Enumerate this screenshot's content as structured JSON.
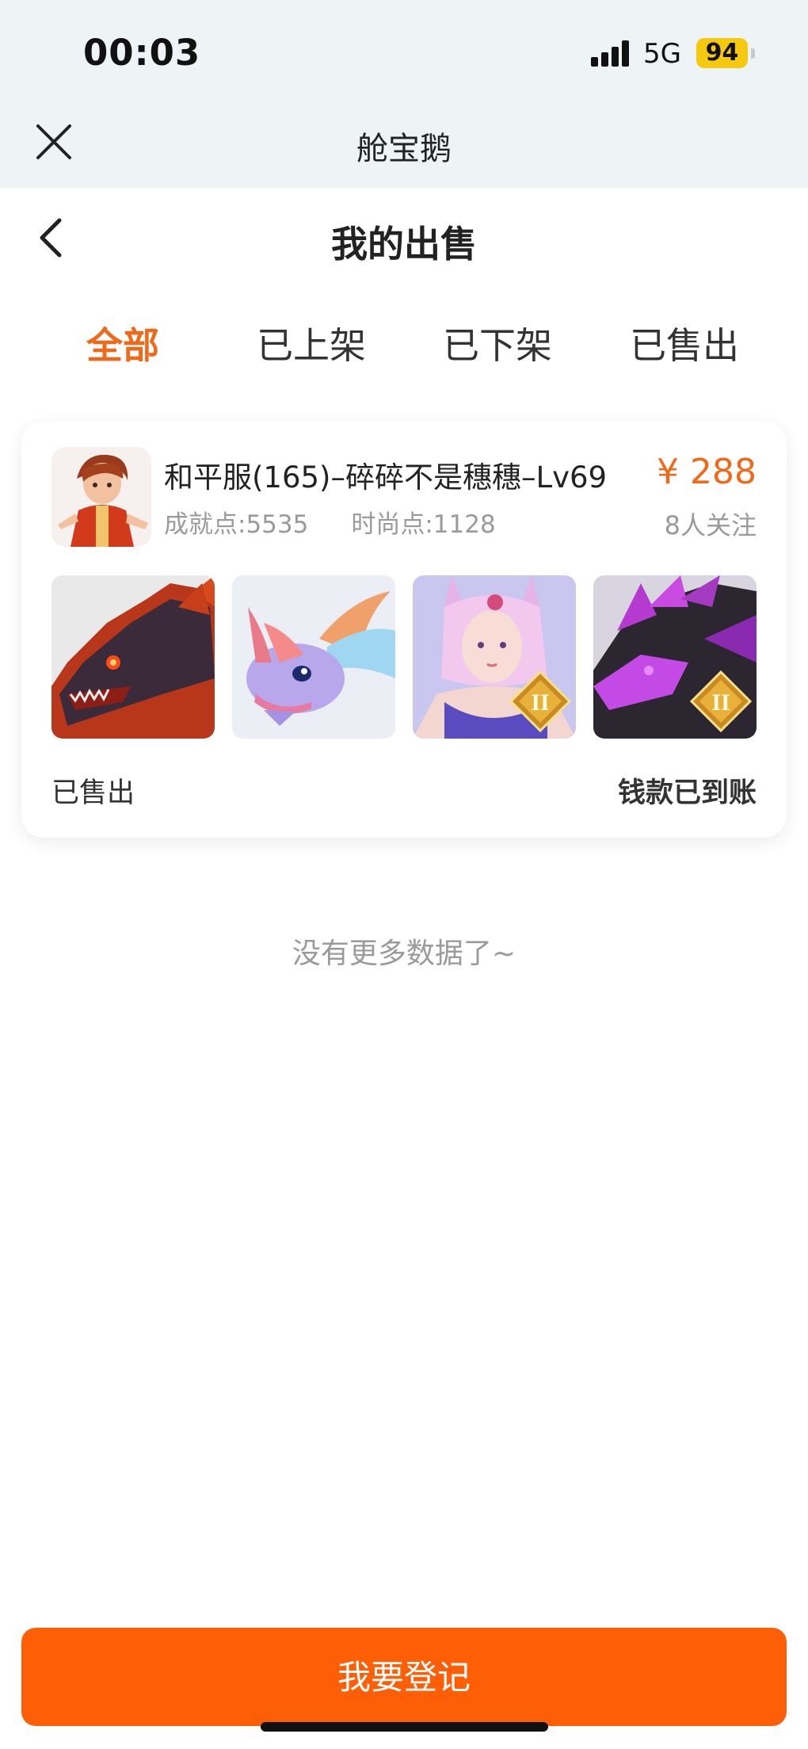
{
  "status_bar": {
    "time": "00:03",
    "network": "5G",
    "battery": "94"
  },
  "header": {
    "app_title": "舱宝鹅"
  },
  "page": {
    "title": "我的出售"
  },
  "tabs": [
    {
      "label": "全部",
      "active": true
    },
    {
      "label": "已上架",
      "active": false
    },
    {
      "label": "已下架",
      "active": false
    },
    {
      "label": "已售出",
      "active": false
    }
  ],
  "listing": {
    "title": "和平服(165)–碎碎不是穗穗–Lv69",
    "achievement": "成就点:5535",
    "fashion": "时尚点:1128",
    "price": "¥ 288",
    "followers": "8人关注",
    "thumbnails": [
      {
        "icon": "dark-dragon-icon",
        "badge": false
      },
      {
        "icon": "pastel-dragon-icon",
        "badge": false
      },
      {
        "icon": "fox-girl-icon",
        "badge": true,
        "badge_text": "II"
      },
      {
        "icon": "purple-dragon-icon",
        "badge": true,
        "badge_text": "II"
      }
    ],
    "status": "已售出",
    "payment_status": "钱款已到账"
  },
  "footer_note": "没有更多数据了~",
  "cta": {
    "label": "我要登记"
  },
  "colors": {
    "accent": "#f0691a",
    "cta": "#fe5f06",
    "header_bg": "#eef3f6"
  }
}
